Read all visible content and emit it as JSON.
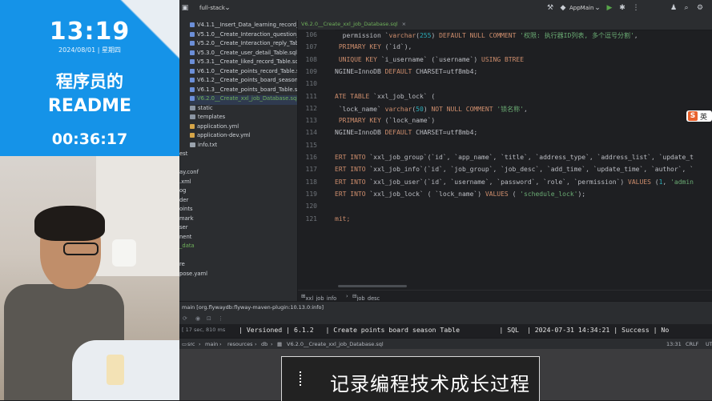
{
  "overlay": {
    "clock": "13:19",
    "date": "2024/08/01 | 星期四",
    "title_line1": "程序员的",
    "title_line2": "README",
    "timer": "00:36:17"
  },
  "ide": {
    "project": "full-stack",
    "run_config": "AppMain",
    "tab": {
      "label": "V6.2.0__Create_xxl_job_Database.sql"
    },
    "tree": [
      {
        "label": "V4.1.1__Insert_Data_learning_record_Ta",
        "type": "sql"
      },
      {
        "label": "V5.1.0__Create_Interaction_question_T",
        "type": "sql"
      },
      {
        "label": "V5.2.0__Create_Interaction_reply_Table",
        "type": "sql"
      },
      {
        "label": "V5.3.0__Create_user_detail_Table.sql",
        "type": "sql"
      },
      {
        "label": "V5.3.1__Create_liked_record_Table.sql",
        "type": "sql"
      },
      {
        "label": "V6.1.0__Create_points_record_Table.sq",
        "type": "sql"
      },
      {
        "label": "V6.1.2__Create_points_board_season_",
        "type": "sql"
      },
      {
        "label": "V6.1.3__Create_points_board_Table.sq",
        "type": "sql"
      },
      {
        "label": "V6.2.0__Create_xxl_job_Database.sql",
        "type": "sql-selected"
      },
      {
        "label": "static",
        "type": "folder"
      },
      {
        "label": "templates",
        "type": "folder"
      },
      {
        "label": "application.yml",
        "type": "yml"
      },
      {
        "label": "application-dev.yml",
        "type": "yml"
      },
      {
        "label": "info.txt",
        "type": "txt"
      },
      {
        "label": "est",
        "type": "plain"
      },
      {
        "label": "",
        "type": "plain"
      },
      {
        "label": "ay.conf",
        "type": "plain"
      },
      {
        "label": ".xml",
        "type": "plain"
      },
      {
        "label": "og",
        "type": "plain"
      },
      {
        "label": "der",
        "type": "plain"
      },
      {
        "label": "oints",
        "type": "plain"
      },
      {
        "label": "mark",
        "type": "plain"
      },
      {
        "label": "ser",
        "type": "plain"
      },
      {
        "label": "nent",
        "type": "plain"
      },
      {
        "label": "_data",
        "type": "plain-green"
      },
      {
        "label": "",
        "type": "plain"
      },
      {
        "label": "re",
        "type": "plain"
      },
      {
        "label": "pose.yaml",
        "type": "plain"
      }
    ],
    "line_numbers": [
      "106",
      "107",
      "108",
      "109",
      "110",
      "111",
      "112",
      "113",
      "114",
      "115",
      "116",
      "117",
      "118",
      "119",
      "120",
      "121"
    ],
    "code_lines": [
      [
        {
          "t": "  permission `"
        },
        {
          "t": "varchar",
          "c": "kw"
        },
        {
          "t": "("
        },
        {
          "t": "255",
          "c": "num"
        },
        {
          "t": ") "
        },
        {
          "t": "DEFAULT NULL COMMENT ",
          "c": "kw"
        },
        {
          "t": "'权限: 执行器ID列表, 多个逗号分割'",
          "c": "str"
        },
        {
          "t": ","
        }
      ],
      [
        {
          "t": " "
        },
        {
          "t": "PRIMARY KEY",
          "c": "kw"
        },
        {
          "t": " (`id`),"
        }
      ],
      [
        {
          "t": " "
        },
        {
          "t": "UNIQUE KEY",
          "c": "kw"
        },
        {
          "t": " `i_username` (`username`) "
        },
        {
          "t": "USING BTREE",
          "c": "kw"
        }
      ],
      [
        {
          "t": "NGINE=InnoDB "
        },
        {
          "t": "DEFAULT",
          "c": "kw"
        },
        {
          "t": " CHARSET=utf8mb4;"
        }
      ],
      [
        {
          "t": ""
        }
      ],
      [
        {
          "t": "ATE TABLE",
          "c": "kw"
        },
        {
          "t": " `xxl_job_lock` ("
        }
      ],
      [
        {
          "t": " `lock_name` "
        },
        {
          "t": "varchar",
          "c": "kw"
        },
        {
          "t": "("
        },
        {
          "t": "50",
          "c": "num"
        },
        {
          "t": ") "
        },
        {
          "t": "NOT NULL COMMENT ",
          "c": "kw"
        },
        {
          "t": "'锁名称'",
          "c": "str"
        },
        {
          "t": ","
        }
      ],
      [
        {
          "t": " "
        },
        {
          "t": "PRIMARY KEY",
          "c": "kw"
        },
        {
          "t": " (`lock_name`)"
        }
      ],
      [
        {
          "t": "NGINE=InnoDB "
        },
        {
          "t": "DEFAULT",
          "c": "kw"
        },
        {
          "t": " CHARSET=utf8mb4;"
        }
      ],
      [
        {
          "t": ""
        }
      ],
      [
        {
          "t": "ERT INTO",
          "c": "kw"
        },
        {
          "t": " `xxl_job_group`(`id`, `app_name`, `title`, `address_type`, `address_list`, `update_t"
        }
      ],
      [
        {
          "t": "ERT INTO",
          "c": "kw"
        },
        {
          "t": " `xxl_job_info`(`id`, `job_group`, `job_desc`, `add_time`, `update_time`, `author`, `"
        }
      ],
      [
        {
          "t": "ERT INTO",
          "c": "kw"
        },
        {
          "t": " `xxl_job_user`(`id`, `username`, `password`, `role`, `permission`) "
        },
        {
          "t": "VALUES",
          "c": "kw"
        },
        {
          "t": " ("
        },
        {
          "t": "1",
          "c": "num"
        },
        {
          "t": ", "
        },
        {
          "t": "'admin",
          "c": "str"
        }
      ],
      [
        {
          "t": "ERT INTO",
          "c": "kw"
        },
        {
          "t": " `xxl_job_lock` ( `lock_name`) "
        },
        {
          "t": "VALUES",
          "c": "kw"
        },
        {
          "t": " ( "
        },
        {
          "t": "'schedule_lock'",
          "c": "str"
        },
        {
          "t": ");"
        }
      ],
      [
        {
          "t": ""
        }
      ],
      [
        {
          "t": "mit;",
          "c": "kw"
        }
      ]
    ],
    "breadcrumbs": [
      "xxl_job_info",
      "job_desc"
    ],
    "run_tab": "main [org.flywaydb:flyway-maven-plugin:10.13.0:info]",
    "console": {
      "time": "[ 17 sec, 810 ms",
      "log": "| Versioned | 6.1.2   | Create points board season Table          | SQL  | 2024-07-31 14:34:21 | Success | No"
    },
    "status": {
      "path": [
        "src",
        "main",
        "resources",
        "db",
        "V6.2.0__Create_xxl_job_Database.sql"
      ],
      "position": "13:31",
      "line_ending": "CRLF",
      "encoding": "UTF"
    }
  },
  "ime": {
    "label": "英"
  },
  "subtitle": "记录编程技术成长过程"
}
